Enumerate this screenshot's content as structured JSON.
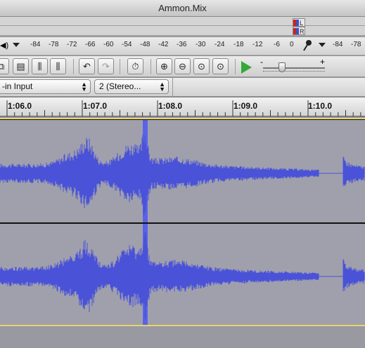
{
  "window": {
    "title": "Ammon.Mix"
  },
  "meters": {
    "left_label": "L",
    "right_label": "R",
    "playback_scale": [
      "-84",
      "-78",
      "-72",
      "-66",
      "-60",
      "-54",
      "-48",
      "-42",
      "-36",
      "-30",
      "-24",
      "-18",
      "-12",
      "-6",
      "0"
    ],
    "record_scale": [
      "-84",
      "-78"
    ]
  },
  "toolbar": {
    "gain_minus": "-",
    "gain_plus": "+"
  },
  "device": {
    "input_source": "-in Input",
    "channels": "2 (Stereo..."
  },
  "timeline": {
    "labels": [
      "1:06.0",
      "1:07.0",
      "1:08.0",
      "1:09.0",
      "1:10.0"
    ]
  },
  "colors": {
    "waveform": "#4a52d8",
    "selection": "#5a62e8",
    "track_bg": "#a0a0ac",
    "clip_edge": "#e6d46a"
  }
}
